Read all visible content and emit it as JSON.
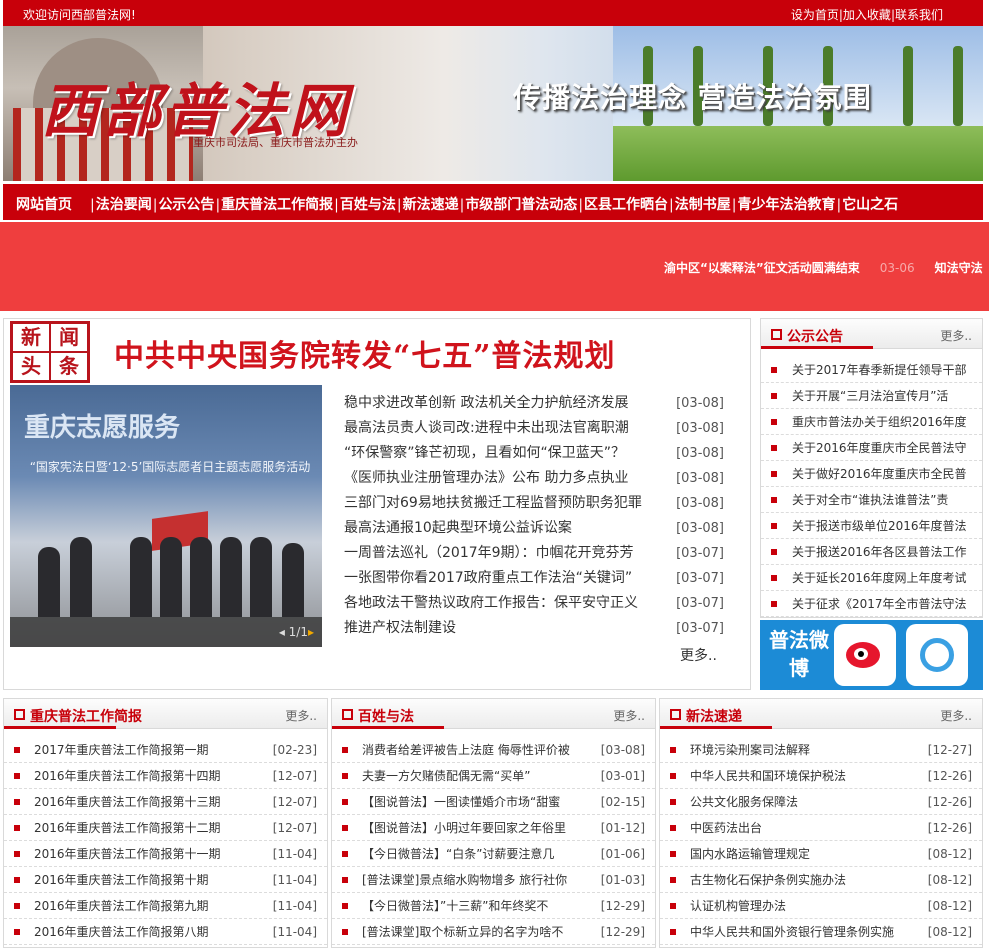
{
  "topbar": {
    "welcome": "欢迎访问西部普法网!",
    "links": [
      "设为首页",
      "加入收藏",
      "联系我们"
    ]
  },
  "banner": {
    "logo": "西部普法网",
    "subtitle": "重庆市司法局、重庆市普法办主办",
    "slogan": "传播法治理念 营造法治氛围"
  },
  "nav": {
    "home": "网站首页",
    "items": [
      "法治要闻",
      "公示公告",
      "重庆普法工作简报",
      "百姓与法",
      "新法速递",
      "市级部门普法动态",
      "区县工作晒台",
      "法制书屋",
      "青少年法治教育",
      "它山之石"
    ]
  },
  "ticker": {
    "text": "渝中区“以案释法”征文活动圆满结束",
    "date": "03-06",
    "text2": "知法守法"
  },
  "headline_box": {
    "badge": [
      "新",
      "闻",
      "头",
      "条"
    ],
    "headline": "中共中央国务院转发“七五”普法规划",
    "photo_title": "重庆志愿服务",
    "photo_caption": "“国家宪法日暨‘12·5’国际志愿者日主题志愿服务活动",
    "pager_current": "1/1",
    "news": [
      {
        "title": "稳中求进改革创新 政法机关全力护航经济发展",
        "date": "[03-08]"
      },
      {
        "title": "最高法员责人谈司改:进程中未出现法官离职潮",
        "date": "[03-08]"
      },
      {
        "title": "“环保警察”锋芒初现，且看如何“保卫蓝天”？",
        "date": "[03-08]"
      },
      {
        "title": "《医师执业注册管理办法》公布 助力多点执业",
        "date": "[03-08]"
      },
      {
        "title": "三部门对69易地扶贫搬迁工程监督预防职务犯罪",
        "date": "[03-08]"
      },
      {
        "title": "最高法通报10起典型环境公益诉讼案",
        "date": "[03-08]"
      },
      {
        "title": "一周普法巡礼（2017年9期）：巾帼花开竞芬芳",
        "date": "[03-07]"
      },
      {
        "title": "一张图带你看2017政府重点工作法治“关键词”",
        "date": "[03-07]"
      },
      {
        "title": "各地政法干警热议政府工作报告：保平安守正义",
        "date": "[03-07]"
      },
      {
        "title": "推进产权法制建设",
        "date": "[03-07]"
      }
    ],
    "more": "更多.."
  },
  "notice": {
    "title": "公示公告",
    "more": "更多..",
    "items": [
      "关于2017年春季新提任领导干部",
      "关于开展“三月法治宣传月”活",
      "重庆市普法办关于组织2016年度",
      "关于2016年度重庆市全民普法守",
      "关于做好2016年度重庆市全民普",
      "关于对全市“谁执法谁普法”责",
      "关于报送市级单位2016年度普法",
      "关于报送2016年各区县普法工作",
      "关于延长2016年度网上年度考试",
      "关于征求《2017年全市普法守法"
    ]
  },
  "weibo": {
    "label": "普法微博"
  },
  "panel_briefing": {
    "title": "重庆普法工作简报",
    "more": "更多..",
    "items": [
      {
        "title": "2017年重庆普法工作简报第一期",
        "date": "[02-23]"
      },
      {
        "title": "2016年重庆普法工作简报第十四期",
        "date": "[12-07]"
      },
      {
        "title": "2016年重庆普法工作简报第十三期",
        "date": "[12-07]"
      },
      {
        "title": "2016年重庆普法工作简报第十二期",
        "date": "[12-07]"
      },
      {
        "title": "2016年重庆普法工作简报第十一期",
        "date": "[11-04]"
      },
      {
        "title": "2016年重庆普法工作简报第十期",
        "date": "[11-04]"
      },
      {
        "title": "2016年重庆普法工作简报第九期",
        "date": "[11-04]"
      },
      {
        "title": "2016年重庆普法工作简报第八期",
        "date": "[11-04]"
      }
    ]
  },
  "panel_people": {
    "title": "百姓与法",
    "more": "更多..",
    "items": [
      {
        "title": "消费者给差评被告上法庭 侮辱性评价被",
        "date": "[03-08]"
      },
      {
        "title": "夫妻一方欠赌债配偶无需“买单”",
        "date": "[03-01]"
      },
      {
        "title": "【图说普法】一图读懂婚介市场“甜蜜",
        "date": "[02-15]"
      },
      {
        "title": "【图说普法】小明过年要回家之年俗里",
        "date": "[01-12]"
      },
      {
        "title": "【今日微普法】“白条”讨薪要注意几",
        "date": "[01-06]"
      },
      {
        "title": "[普法课堂]景点缩水购物增多 旅行社你",
        "date": "[01-03]"
      },
      {
        "title": "【今日微普法】”十三薪”和年终奖不",
        "date": "[12-29]"
      },
      {
        "title": "[普法课堂]取个标新立异的名字为啥不",
        "date": "[12-29]"
      }
    ]
  },
  "panel_newlaw": {
    "title": "新法速递",
    "more": "更多..",
    "items": [
      {
        "title": "环境污染刑案司法解释",
        "date": "[12-27]"
      },
      {
        "title": "中华人民共和国环境保护税法",
        "date": "[12-26]"
      },
      {
        "title": "公共文化服务保障法",
        "date": "[12-26]"
      },
      {
        "title": "中医药法出台",
        "date": "[12-26]"
      },
      {
        "title": "国内水路运输管理规定",
        "date": "[08-12]"
      },
      {
        "title": "古生物化石保护条例实施办法",
        "date": "[08-12]"
      },
      {
        "title": "认证机构管理办法",
        "date": "[08-12]"
      },
      {
        "title": "中华人民共和国外资银行管理条例实施",
        "date": "[08-12]"
      }
    ]
  }
}
